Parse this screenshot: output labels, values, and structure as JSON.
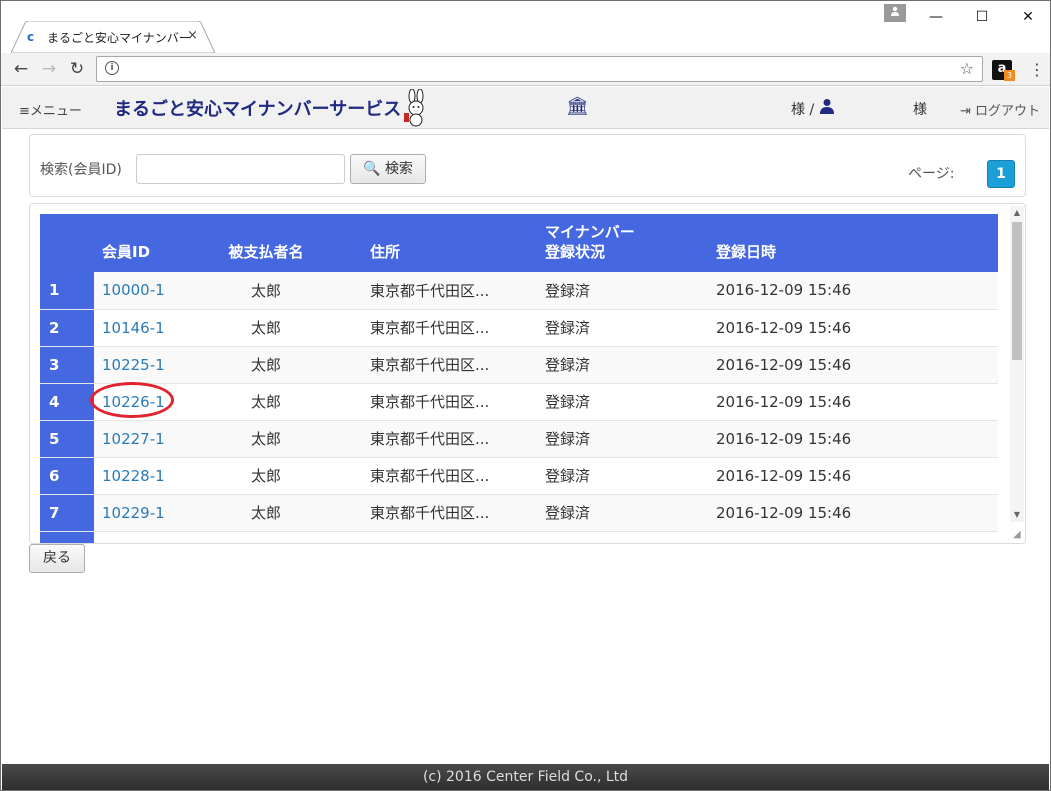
{
  "browser": {
    "tab_title": "まるごと安心マイナンバー",
    "tab_close": "×",
    "favicon_glyph": "c",
    "url": "",
    "profile_icon": "person-icon",
    "amazon_letter": "a",
    "amazon_badge": "3",
    "window_controls": {
      "minimize": "—",
      "maximize": "☐",
      "close": "✕"
    }
  },
  "header": {
    "menu_label": "≡メニュー",
    "brand": "まるごと安心マイナンバーサービス",
    "user_label": "様 /",
    "user_label_2": "様",
    "logout_label": "ログアウト"
  },
  "search": {
    "label": "検索(会員ID)",
    "input_value": "",
    "button_label": "検索",
    "page_label": "ページ:",
    "current_page": "1"
  },
  "table": {
    "columns": [
      "",
      "会員ID",
      "被支払者名",
      "住所",
      "マイナンバー\n登録状況",
      "登録日時"
    ],
    "rows": [
      {
        "no": "1",
        "id": "10000-1",
        "name": "太郎",
        "address": "東京都千代田区...",
        "status": "登録済",
        "date": "2016-12-09 15:46"
      },
      {
        "no": "2",
        "id": "10146-1",
        "name": "太郎",
        "address": "東京都千代田区...",
        "status": "登録済",
        "date": "2016-12-09 15:46"
      },
      {
        "no": "3",
        "id": "10225-1",
        "name": "太郎",
        "address": "東京都千代田区...",
        "status": "登録済",
        "date": "2016-12-09 15:46"
      },
      {
        "no": "4",
        "id": "10226-1",
        "name": "太郎",
        "address": "東京都千代田区...",
        "status": "登録済",
        "date": "2016-12-09 15:46"
      },
      {
        "no": "5",
        "id": "10227-1",
        "name": "太郎",
        "address": "東京都千代田区...",
        "status": "登録済",
        "date": "2016-12-09 15:46"
      },
      {
        "no": "6",
        "id": "10228-1",
        "name": "太郎",
        "address": "東京都千代田区...",
        "status": "登録済",
        "date": "2016-12-09 15:46"
      },
      {
        "no": "7",
        "id": "10229-1",
        "name": "太郎",
        "address": "東京都千代田区...",
        "status": "登録済",
        "date": "2016-12-09 15:46"
      },
      {
        "no": "",
        "id": "",
        "name": "",
        "address": "",
        "status": "",
        "date": ""
      }
    ]
  },
  "actions": {
    "back_label": "戻る"
  },
  "footer": {
    "text": "(c) 2016 Center Field Co., Ltd"
  },
  "colors": {
    "header_blue": "#4567e0",
    "brand_navy": "#1f2a80",
    "link_blue": "#2a7ab8",
    "page_button": "#1a9fd9",
    "highlight_red": "#e2222f"
  }
}
